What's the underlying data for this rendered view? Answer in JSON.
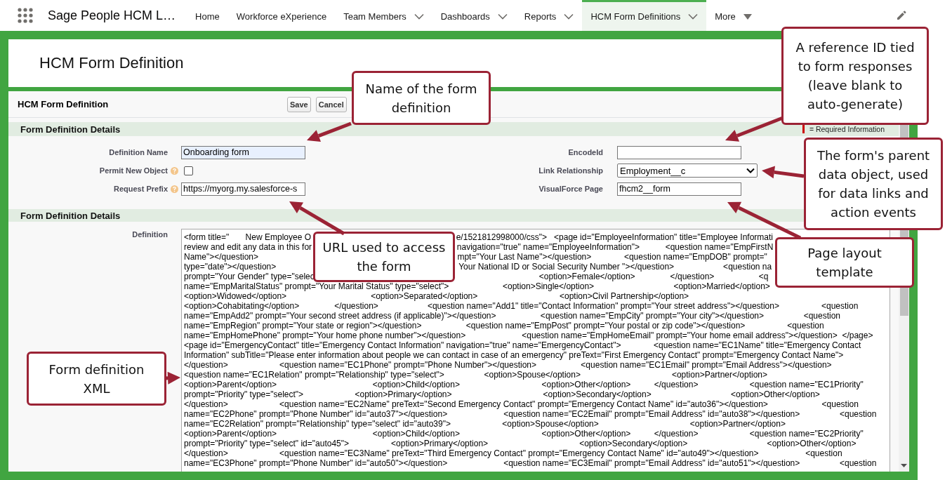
{
  "app_bar": {
    "app_name": "Sage People HCM L…",
    "nav": [
      {
        "label": "Home",
        "selected": false,
        "kind": "plain"
      },
      {
        "label": "Workforce eXperience",
        "selected": false,
        "kind": "plain"
      },
      {
        "label": "Team Members",
        "selected": false,
        "kind": "dropdown"
      },
      {
        "label": "Dashboards",
        "selected": false,
        "kind": "dropdown"
      },
      {
        "label": "Reports",
        "selected": false,
        "kind": "dropdown"
      },
      {
        "label": "HCM Form Definitions",
        "selected": true,
        "kind": "dropdown"
      },
      {
        "label": "More",
        "selected": false,
        "kind": "more"
      }
    ]
  },
  "page_title": "HCM Form Definition",
  "edit_block": {
    "title": "HCM Form Definition",
    "buttons": [
      "Save",
      "Cancel"
    ],
    "sections": [
      {
        "title": "Form Definition Details",
        "legend": "= Required Information",
        "left_fields": [
          {
            "label": "Definition Name",
            "kind": "text",
            "value": "Onboarding form",
            "help": false,
            "focused": true
          },
          {
            "label": "Permit New Object",
            "kind": "checkbox",
            "checked": false,
            "help": true
          },
          {
            "label": "Request Prefix",
            "kind": "text",
            "value": "https://myorg.my.salesforce-s",
            "help": true,
            "focused": false
          }
        ],
        "right_fields": [
          {
            "label": "EncodeId",
            "kind": "text",
            "help": false,
            "focused": false
          },
          {
            "label": "Link Relationship",
            "kind": "select",
            "value": "Employment__c",
            "help": false
          },
          {
            "label": "VisualForce Page",
            "kind": "text",
            "value": "fhcm2__form",
            "help": false,
            "focused": false
          }
        ]
      },
      {
        "title": "Form Definition Details",
        "fields": [
          {
            "label": "Definition",
            "kind": "textarea",
            "help": false,
            "lines": [
              "<form title=\"       New Employee O                                                              e/1521812998000/css\">   <page id=\"EmployeeInformation\" title=\"Employee Informati",
              "review and edit any data in this for                                                              navigation=\"true\" name=\"EmployeeInformation\">           <question name=\"EmpFirstN",
              "Name\"></question>                                                                                     mpt=\"Your Last Name\"></question>              <question name=\"EmpDOB\" prompt=\"",
              "type=\"date\"></question>                                                                              Your National ID or Social Security Number \"></question>                     <question na",
              "prompt=\"Your Gender\" type=\"selec                                                                                                <option>Female</option>               </question>                   <q",
              "name=\"EmpMaritalStatus\" prompt=\"Your Marital Status\" type=\"select\">                       <option>Single</option>                                  <option>Married</option>",
              "<option>Widowed</option>                                    <option>Separated</option>                                   <option>Civil Partnership</option>",
              "<option>Cohabitating</option>               </question>                     <question name=\"Add1\" title=\"Contact Information\" prompt=\"Your street address\"></question>                  <question",
              "name=\"EmpAdd2\" prompt=\"Your second street address (if applicable)\"></question>                   <question name=\"EmpCity\" prompt=\"Your city\"></question>                 <question",
              "name=\"EmpRegion\" prompt=\"Your state or region\"></question>                   <question name=\"EmpPost\" prompt=\"Your postal or zip code\"></question>                  <question",
              "name=\"EmpHomePhone\" prompt=\"Your home phone number\"></question>                        <question name=\"EmpHomeEmail\" prompt=\"Your home email address\"></question>  </page>",
              "<page id=\"EmergencyContact\" title=\"Emergency Contact Information\" navigation=\"true\" name=\"EmergencyContact\">              <question name=\"EC1Name\" title=\"Emergency Contact",
              "Information\" subTitle=\"Please enter information about people we can contact in case of an emergency\" preText=\"First Emergency Contact\" prompt=\"Emergency Contact Name\">",
              "</question>                      <question name=\"EC1Phone\" prompt=\"Phone Number\"></question>                   <question name=\"EC1Email\" prompt=\"Email Address\"></question>",
              "<question name=\"EC1Relation\" prompt=\"Relationship\" type=\"select\">                 <option>Spouse</option>                                       <option>Partner</option>",
              "<option>Parent</option>                                         <option>Child</option>                                   <option>Other</option>          </question>                      <question name=\"EC1Priority\"",
              "prompt=\"Priority\" type=\"select\">                      <option>Primary</option>                                       <option>Secondary</option>                                  <option>Other</option>",
              "</question>                      <question name=\"EC2Name\" preText=\"Second Emergency Contact\" prompt=\"Emergency Contact Name\" id=\"auto36\"></question>                       <question",
              "name=\"EC2Phone\" prompt=\"Phone Number\" id=\"auto37\"></question>                        <question name=\"EC2Email\" prompt=\"Email Address\" id=\"auto38\"></question>                 <question",
              "name=\"EC2Relation\" prompt=\"Relationship\" type=\"select\" id=\"auto39\">                      <option>Spouse</option>                                       <option>Partner</option>",
              "<option>Parent</option>                                         <option>Child</option>                                   <option>Other</option>          </question>                      <question name=\"EC2Priority\"",
              "prompt=\"Priority\" type=\"select\" id=\"auto45\">                  <option>Primary</option>                                       <option>Secondary</option>                                  <option>Other</option>",
              "</question>                      <question name=\"EC3Name\" preText=\"Third Emergency Contact\" prompt=\"Emergency Contact Name\" id=\"auto49\"></question>                    <question",
              "name=\"EC3Phone\" prompt=\"Phone Number\" id=\"auto50\"></question>                        <question name=\"EC3Email\" prompt=\"Email Address\" id=\"auto51\"></question>                 <question"
            ]
          }
        ]
      }
    ]
  },
  "callouts": [
    {
      "lines": [
        "Name of the form",
        "definition"
      ]
    },
    {
      "lines": [
        "A reference ID tied",
        "to form responses",
        "(leave blank to",
        "auto-generate)"
      ]
    },
    {
      "lines": [
        "The form's parent",
        "data object, used",
        "for data links and",
        "action events"
      ]
    },
    {
      "lines": [
        "URL used to access",
        "the form"
      ]
    },
    {
      "lines": [
        "Page layout",
        "template"
      ]
    },
    {
      "lines": [
        "Form definition",
        "XML"
      ]
    }
  ]
}
